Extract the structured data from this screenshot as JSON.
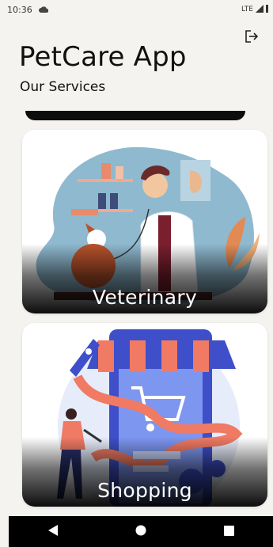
{
  "status_bar": {
    "time": "10:36",
    "network": "LTE",
    "icons": [
      "cloud-icon",
      "signal-icon",
      "battery-icon"
    ]
  },
  "header": {
    "title": "PetCare App",
    "subtitle": "Our Services",
    "logout_icon": "logout-icon"
  },
  "services": [
    {
      "label": "Veterinary"
    },
    {
      "label": "Shopping"
    }
  ],
  "nav_bar": {
    "buttons": [
      "back-icon",
      "home-icon",
      "recents-icon"
    ]
  },
  "colors": {
    "background": "#f4f3ef",
    "card_shade": "#000000",
    "vet_blob": "#8fb9cf",
    "shop_awning_red": "#f07a63",
    "shop_awning_blue": "#3e4fc9"
  }
}
